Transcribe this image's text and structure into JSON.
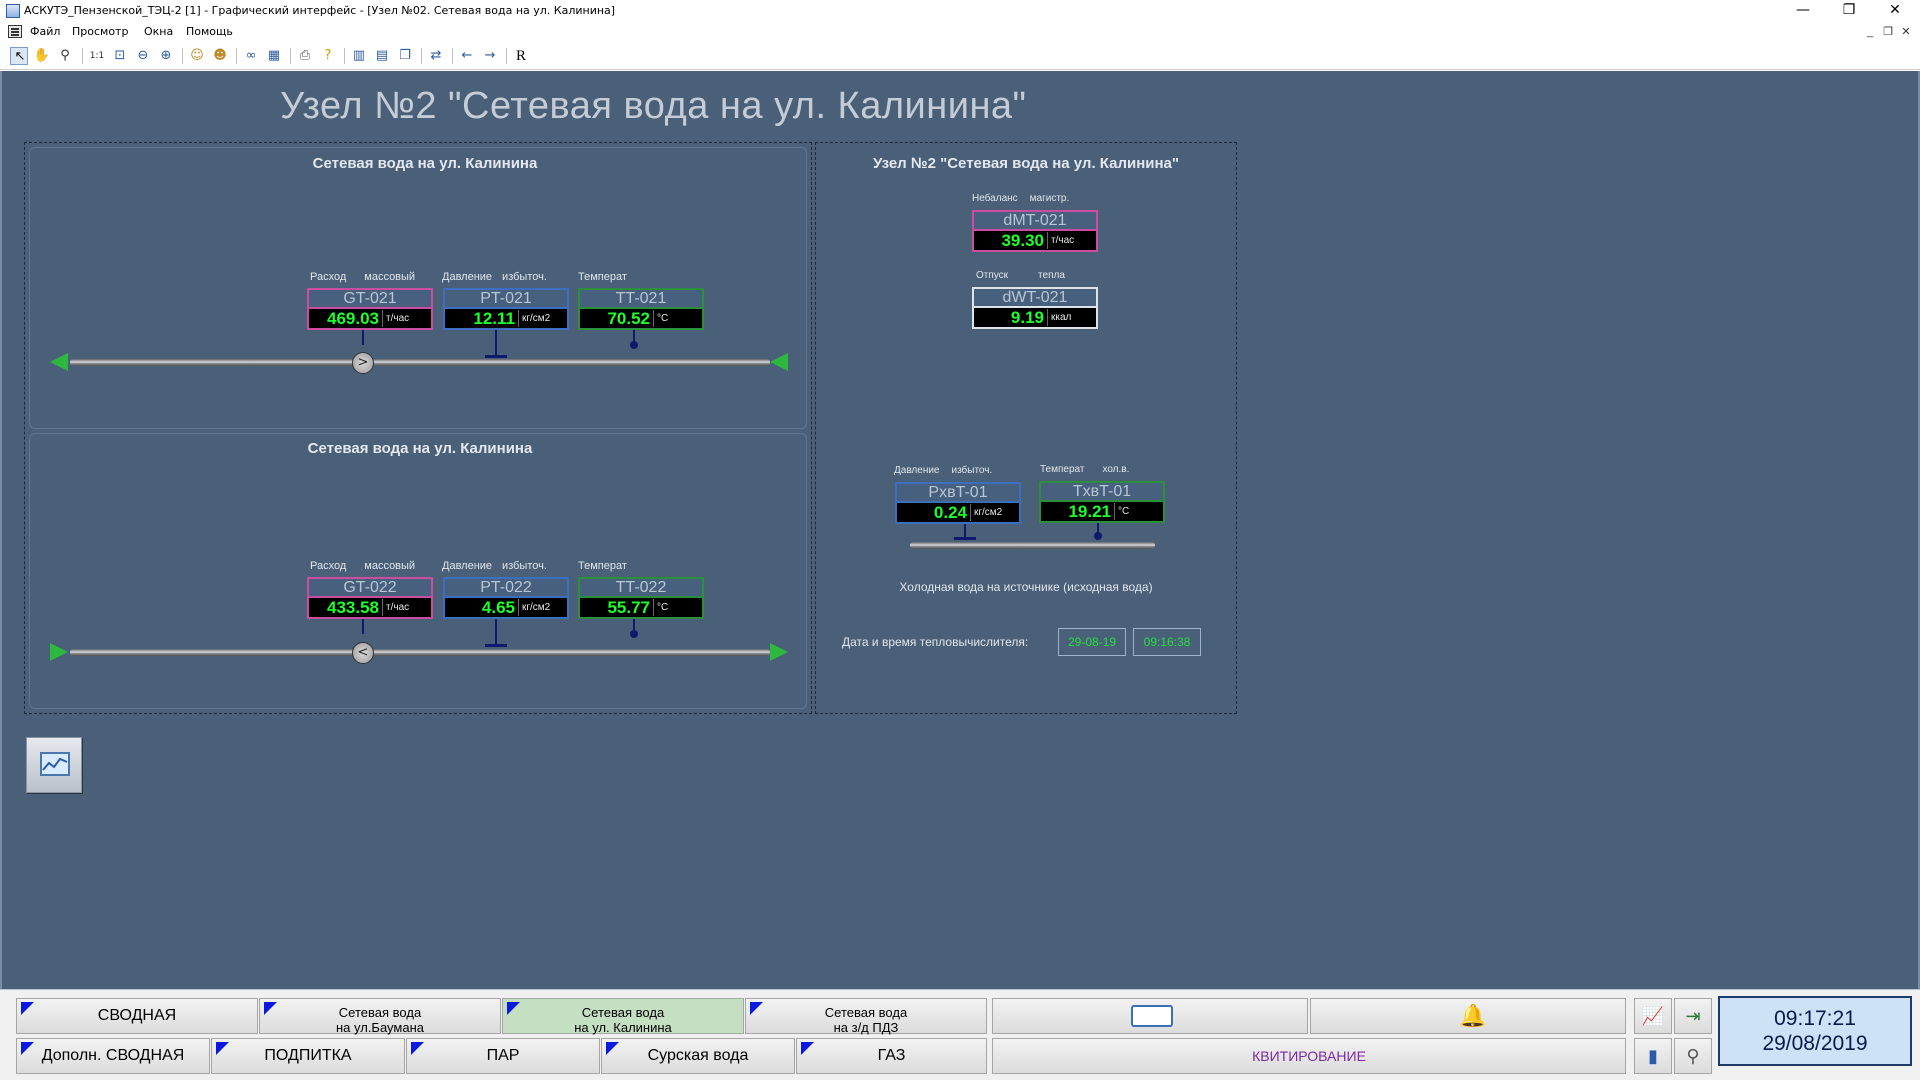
{
  "window": {
    "title": "АСКУТЭ_Пензенской_ТЭЦ-2 [1] - Графический интерфейс - [Узел №02. Сетевая вода на ул. Калинина]",
    "minimize": "—",
    "restore": "❐",
    "close": "✕"
  },
  "menu": {
    "items": [
      "Файл",
      "Просмотр",
      "Окна",
      "Помощь"
    ],
    "mdi_minimize": "_",
    "mdi_restore": "❐",
    "mdi_close": "✕"
  },
  "toolbar": {
    "icons": [
      "select-arrow-icon",
      "hand-pan-icon",
      "zoom-icon",
      "scale-1-1-icon",
      "zoom-fit-icon",
      "zoom-out-icon",
      "zoom-in-icon",
      "user-icon",
      "users-icon",
      "binoculars-icon",
      "calendar-icon",
      "print-icon",
      "help-icon",
      "panel-left-icon",
      "panel-split-icon",
      "windows-icon",
      "refresh-icon",
      "back-arrow-icon",
      "forward-arrow-icon",
      "r-icon"
    ],
    "r_label": "R"
  },
  "page": {
    "title": "Узел №2 \"Сетевая вода на ул. Калинина\""
  },
  "upper_section": {
    "heading": "Сетевая вода на ул. Калинина",
    "labels": {
      "flow": [
        "Расход",
        "массовый"
      ],
      "pressure": [
        "Давление",
        "избыточ."
      ],
      "temp": [
        "Температ",
        ""
      ]
    },
    "sensors": [
      {
        "tag": "GT-021",
        "value": "469.03",
        "unit": "т/час"
      },
      {
        "tag": "PT-021",
        "value": "12.11",
        "unit": "кг/см2"
      },
      {
        "tag": "TT-021",
        "value": "70.52",
        "unit": "°C"
      }
    ]
  },
  "lower_section": {
    "heading": "Сетевая вода на ул. Калинина",
    "labels": {
      "flow": [
        "Расход",
        "массовый"
      ],
      "pressure": [
        "Давление",
        "избыточ."
      ],
      "temp": [
        "Температ",
        ""
      ]
    },
    "sensors": [
      {
        "tag": "GT-022",
        "value": "433.58",
        "unit": "т/час"
      },
      {
        "tag": "PT-022",
        "value": "4.65",
        "unit": "кг/см2"
      },
      {
        "tag": "TT-022",
        "value": "55.77",
        "unit": "°C"
      }
    ]
  },
  "right_panel": {
    "heading": "Узел №2 \"Сетевая вода на ул. Калинина\"",
    "imbalance": {
      "label": [
        "Небаланс",
        "магистр."
      ],
      "tag": "dMT-021",
      "value": "39.30",
      "unit": "т/час"
    },
    "heat": {
      "label": [
        "Отпуск",
        "тепла"
      ],
      "tag": "dWT-021",
      "value": "9.19",
      "unit": "ккал"
    },
    "cold_pressure": {
      "label": [
        "Давление",
        "избыточ."
      ],
      "tag": "PхвT-01",
      "value": "0.24",
      "unit": "кг/см2"
    },
    "cold_temp": {
      "label": [
        "Температ",
        "хол.в."
      ],
      "tag": "TхвT-01",
      "value": "19.21",
      "unit": "°C"
    },
    "cold_caption": "Холодная вода на источнике (исходная вода)",
    "datetime_label": "Дата и время тепловычислителя:",
    "date": "29-08-19",
    "time": "09:16:38"
  },
  "nav": {
    "row1": [
      {
        "label": "СВОДНАЯ"
      },
      {
        "label1": "Сетевая вода",
        "label2": "на ул.Баумана"
      },
      {
        "label1": "Сетевая вода",
        "label2": "на ул. Калинина"
      },
      {
        "label1": "Сетевая вода",
        "label2": "на з/д ПДЗ"
      }
    ],
    "row2": [
      {
        "label": "Дополн. СВОДНАЯ"
      },
      {
        "label": "ПОДПИТКА"
      },
      {
        "label": "ПАР"
      },
      {
        "label": "Сурская вода"
      },
      {
        "label": "ГАЗ"
      }
    ],
    "kvit": "КВИТИРОВАНИЕ",
    "clock_time": "09:17:21",
    "clock_date": "29/08/2019"
  },
  "colors": {
    "background": "#4a5f78",
    "value_green": "#1dff2a",
    "flow_border": "#cc4ca0",
    "pressure_border": "#3c6fc0",
    "temp_border": "#2c8f3c",
    "flag_blue": "#0b19e0",
    "active_tab": "#c5dfc3"
  }
}
